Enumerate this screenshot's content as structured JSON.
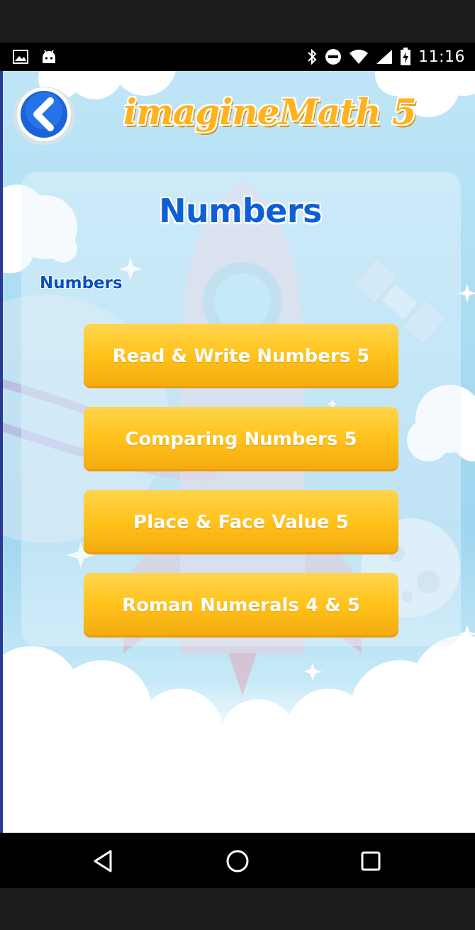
{
  "status_bar": {
    "time": "11:16",
    "icons_left": [
      "image-icon",
      "android-icon"
    ],
    "icons_right": [
      "bluetooth-icon",
      "do-not-disturb-icon",
      "wifi-icon",
      "cell-signal-icon",
      "battery-charging-icon"
    ]
  },
  "header": {
    "logo_text": "imagineMath 5",
    "back_icon": "chevron-left-icon"
  },
  "panel": {
    "title": "Numbers",
    "section_label": "Numbers",
    "topics": [
      {
        "label": "Read & Write Numbers 5"
      },
      {
        "label": "Comparing Numbers 5"
      },
      {
        "label": "Place & Face Value 5"
      },
      {
        "label": "Roman Numerals 4 & 5"
      }
    ]
  },
  "nav_bar": {
    "buttons": [
      "back-triangle-icon",
      "home-circle-icon",
      "recents-square-icon"
    ]
  },
  "colors": {
    "accent_orange": "#ffc21a",
    "title_blue": "#0e5fd6",
    "sky_blue": "#aadcf2"
  }
}
